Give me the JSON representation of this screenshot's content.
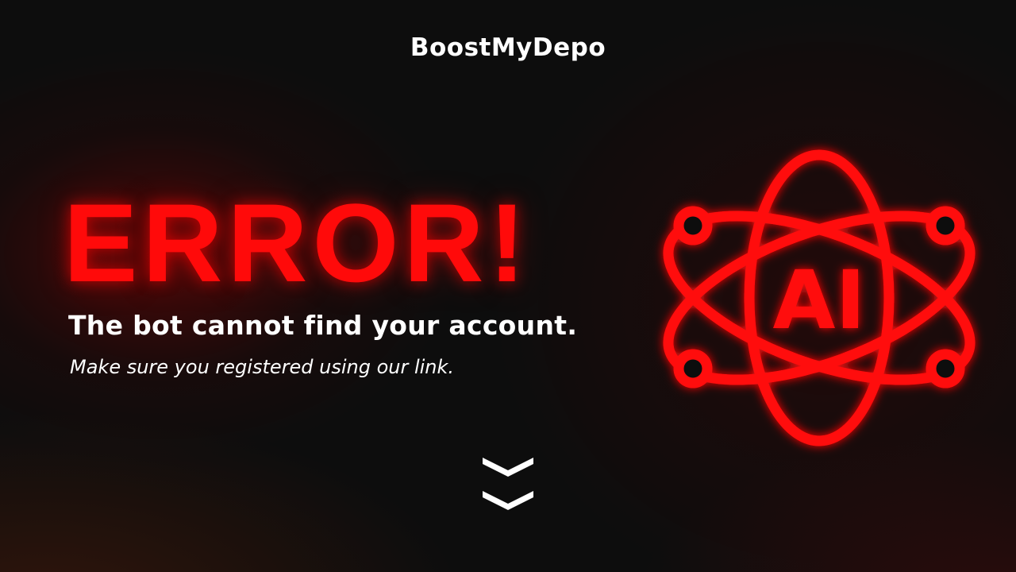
{
  "brand": {
    "name": "BoostMyDepo"
  },
  "error": {
    "title": "ERROR!",
    "message": "The bot cannot find your account.",
    "hint": "Make sure you registered using our link."
  },
  "illustration": {
    "icon": "ai-atom-icon",
    "label": "AI",
    "color": "#ff0a0a"
  },
  "scroll": {
    "icon": "double-chevron-down-icon"
  },
  "colors": {
    "accent": "#ff0a0a",
    "background": "#0d0d0d",
    "text": "#ffffff"
  }
}
